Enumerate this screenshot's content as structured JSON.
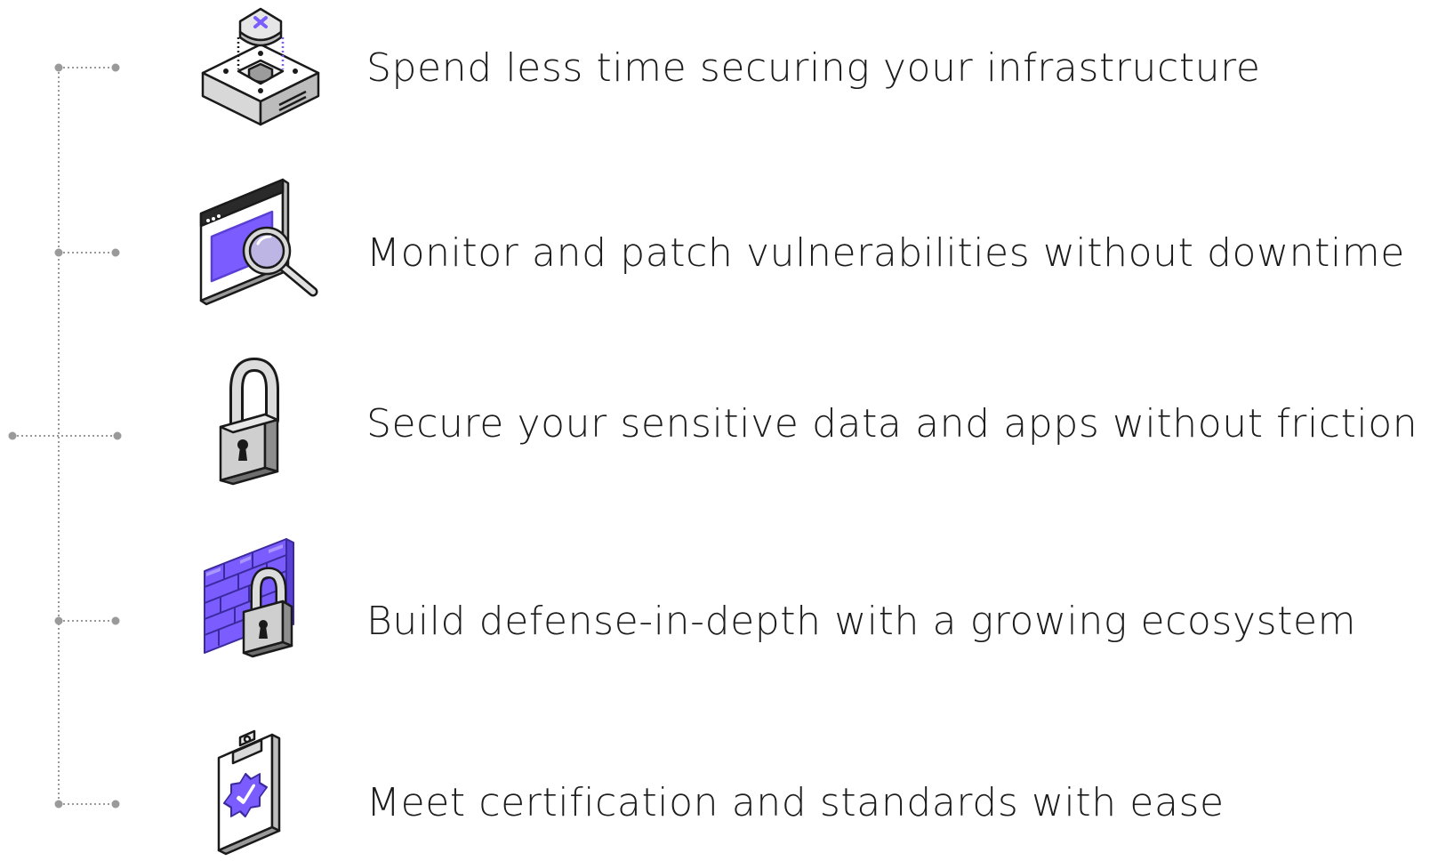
{
  "features": [
    {
      "label": "Spend less time securing your infrastructure",
      "icon": "shield-server-icon"
    },
    {
      "label": "Monitor and patch vulnerabilities without downtime",
      "icon": "browser-magnifier-icon"
    },
    {
      "label": "Secure your sensitive data and apps without friction",
      "icon": "padlock-icon"
    },
    {
      "label": "Build defense-in-depth with a growing ecosystem",
      "icon": "firewall-lock-icon"
    },
    {
      "label": "Meet certification and standards with ease",
      "icon": "clipboard-badge-icon"
    }
  ],
  "colors": {
    "accent": "#7b5cff",
    "accent_dark": "#5a3fd6",
    "connector": "#9a9a9a",
    "text": "#1c1c1c"
  }
}
